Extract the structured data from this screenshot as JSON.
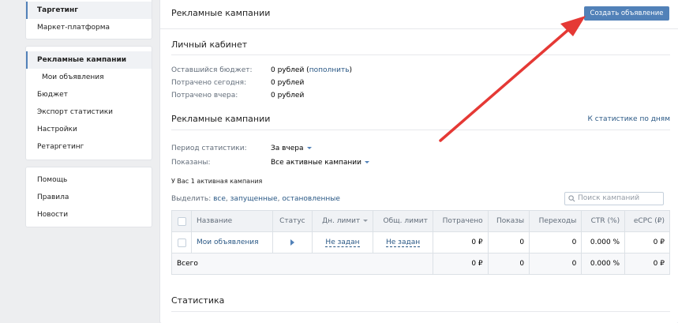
{
  "sidebar": {
    "group1": [
      "Таргетинг",
      "Маркет-платформа"
    ],
    "group2": [
      "Рекламные кампании",
      "Мои объявления",
      "Бюджет",
      "Экспорт статистики",
      "Настройки",
      "Ретаргетинг"
    ],
    "group3": [
      "Помощь",
      "Правила",
      "Новости"
    ]
  },
  "header": {
    "title": "Рекламные кампании",
    "create_button": "Создать объявление"
  },
  "cabinet": {
    "title": "Личный кабинет",
    "rows": [
      {
        "label": "Оставшийся бюджет:",
        "value": "0 рублей (",
        "link": "пополнить",
        "tail": ")"
      },
      {
        "label": "Потрачено сегодня:",
        "value": "0 рублей"
      },
      {
        "label": "Потрачено вчера:",
        "value": "0 рублей"
      }
    ]
  },
  "campaigns": {
    "title": "Рекламные кампании",
    "stats_link": "К статистике по дням",
    "period_label": "Период статистики:",
    "period_value": "За вчера",
    "shown_label": "Показаны:",
    "shown_value": "Все активные кампании",
    "active_count": "У Вас 1 активная кампания",
    "select_prefix": "Выделить:",
    "select_all": "все",
    "select_running": "запущенные",
    "select_stopped": "остановленные",
    "search_placeholder": "Поиск кампаний"
  },
  "table": {
    "headers": [
      "Название",
      "Статус",
      "Дн. лимит",
      "Общ. лимит",
      "Потрачено",
      "Показы",
      "Переходы",
      "CTR (%)",
      "eCPC (₽)"
    ],
    "row": {
      "name": "Мои объявления",
      "day_limit": "Не задан",
      "total_limit": "Не задан",
      "spent": "0 ₽",
      "shows": "0",
      "clicks": "0",
      "ctr": "0.000 %",
      "ecpc": "0 ₽"
    },
    "total": {
      "label": "Всего",
      "spent": "0 ₽",
      "shows": "0",
      "clicks": "0",
      "ctr": "0.000 %",
      "ecpc": "0 ₽"
    }
  },
  "statistics": {
    "title": "Статистика"
  },
  "colors": {
    "accent": "#5181b8",
    "link": "#2a5885",
    "arrow": "#e53935"
  }
}
